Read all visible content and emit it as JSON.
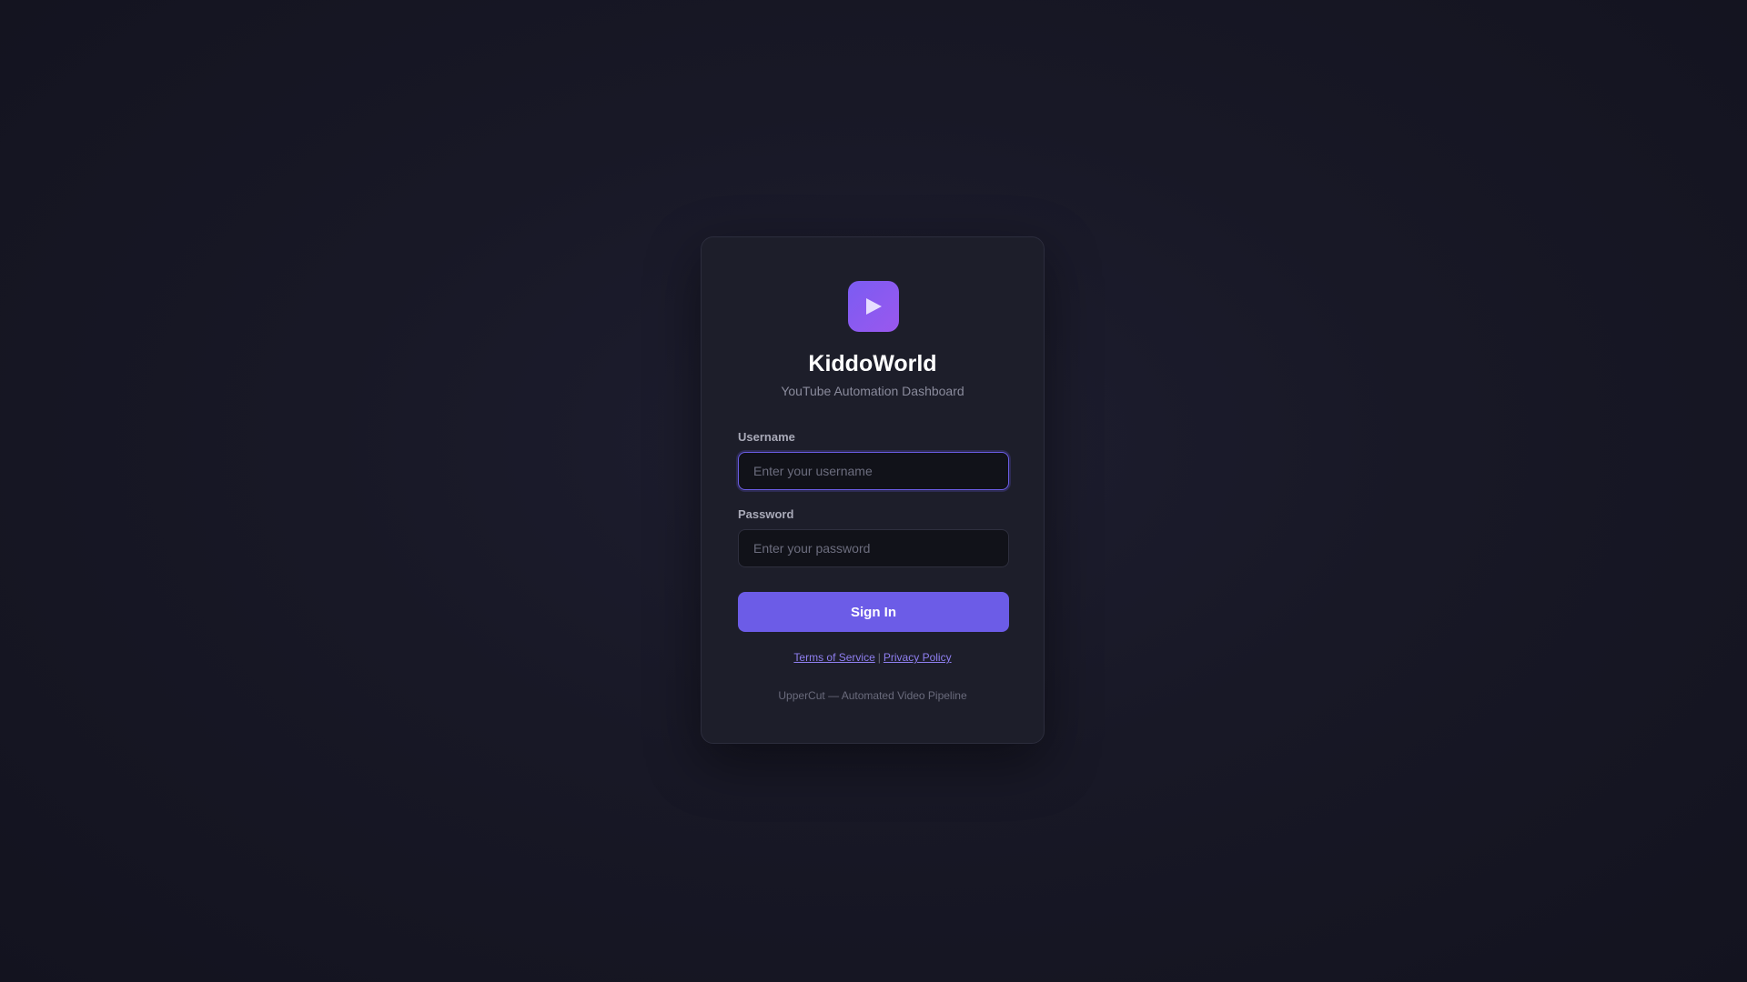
{
  "brand": {
    "logo_icon": "play-icon",
    "title": "KiddoWorld",
    "subtitle": "YouTube Automation Dashboard"
  },
  "form": {
    "username": {
      "label": "Username",
      "value": "",
      "placeholder": "Enter your username"
    },
    "password": {
      "label": "Password",
      "value": "",
      "placeholder": "Enter your password"
    },
    "submit_label": "Sign In"
  },
  "links": {
    "terms": "Terms of Service",
    "separator": "|",
    "privacy": "Privacy Policy"
  },
  "footer": "UpperCut — Automated Video Pipeline",
  "colors": {
    "background": "#181826",
    "card": "#1d1e2a",
    "accent": "#6c5ce7",
    "logo_gradient_start": "#7b5cf2",
    "logo_gradient_end": "#9a58ee",
    "link": "#8f7ff0"
  }
}
